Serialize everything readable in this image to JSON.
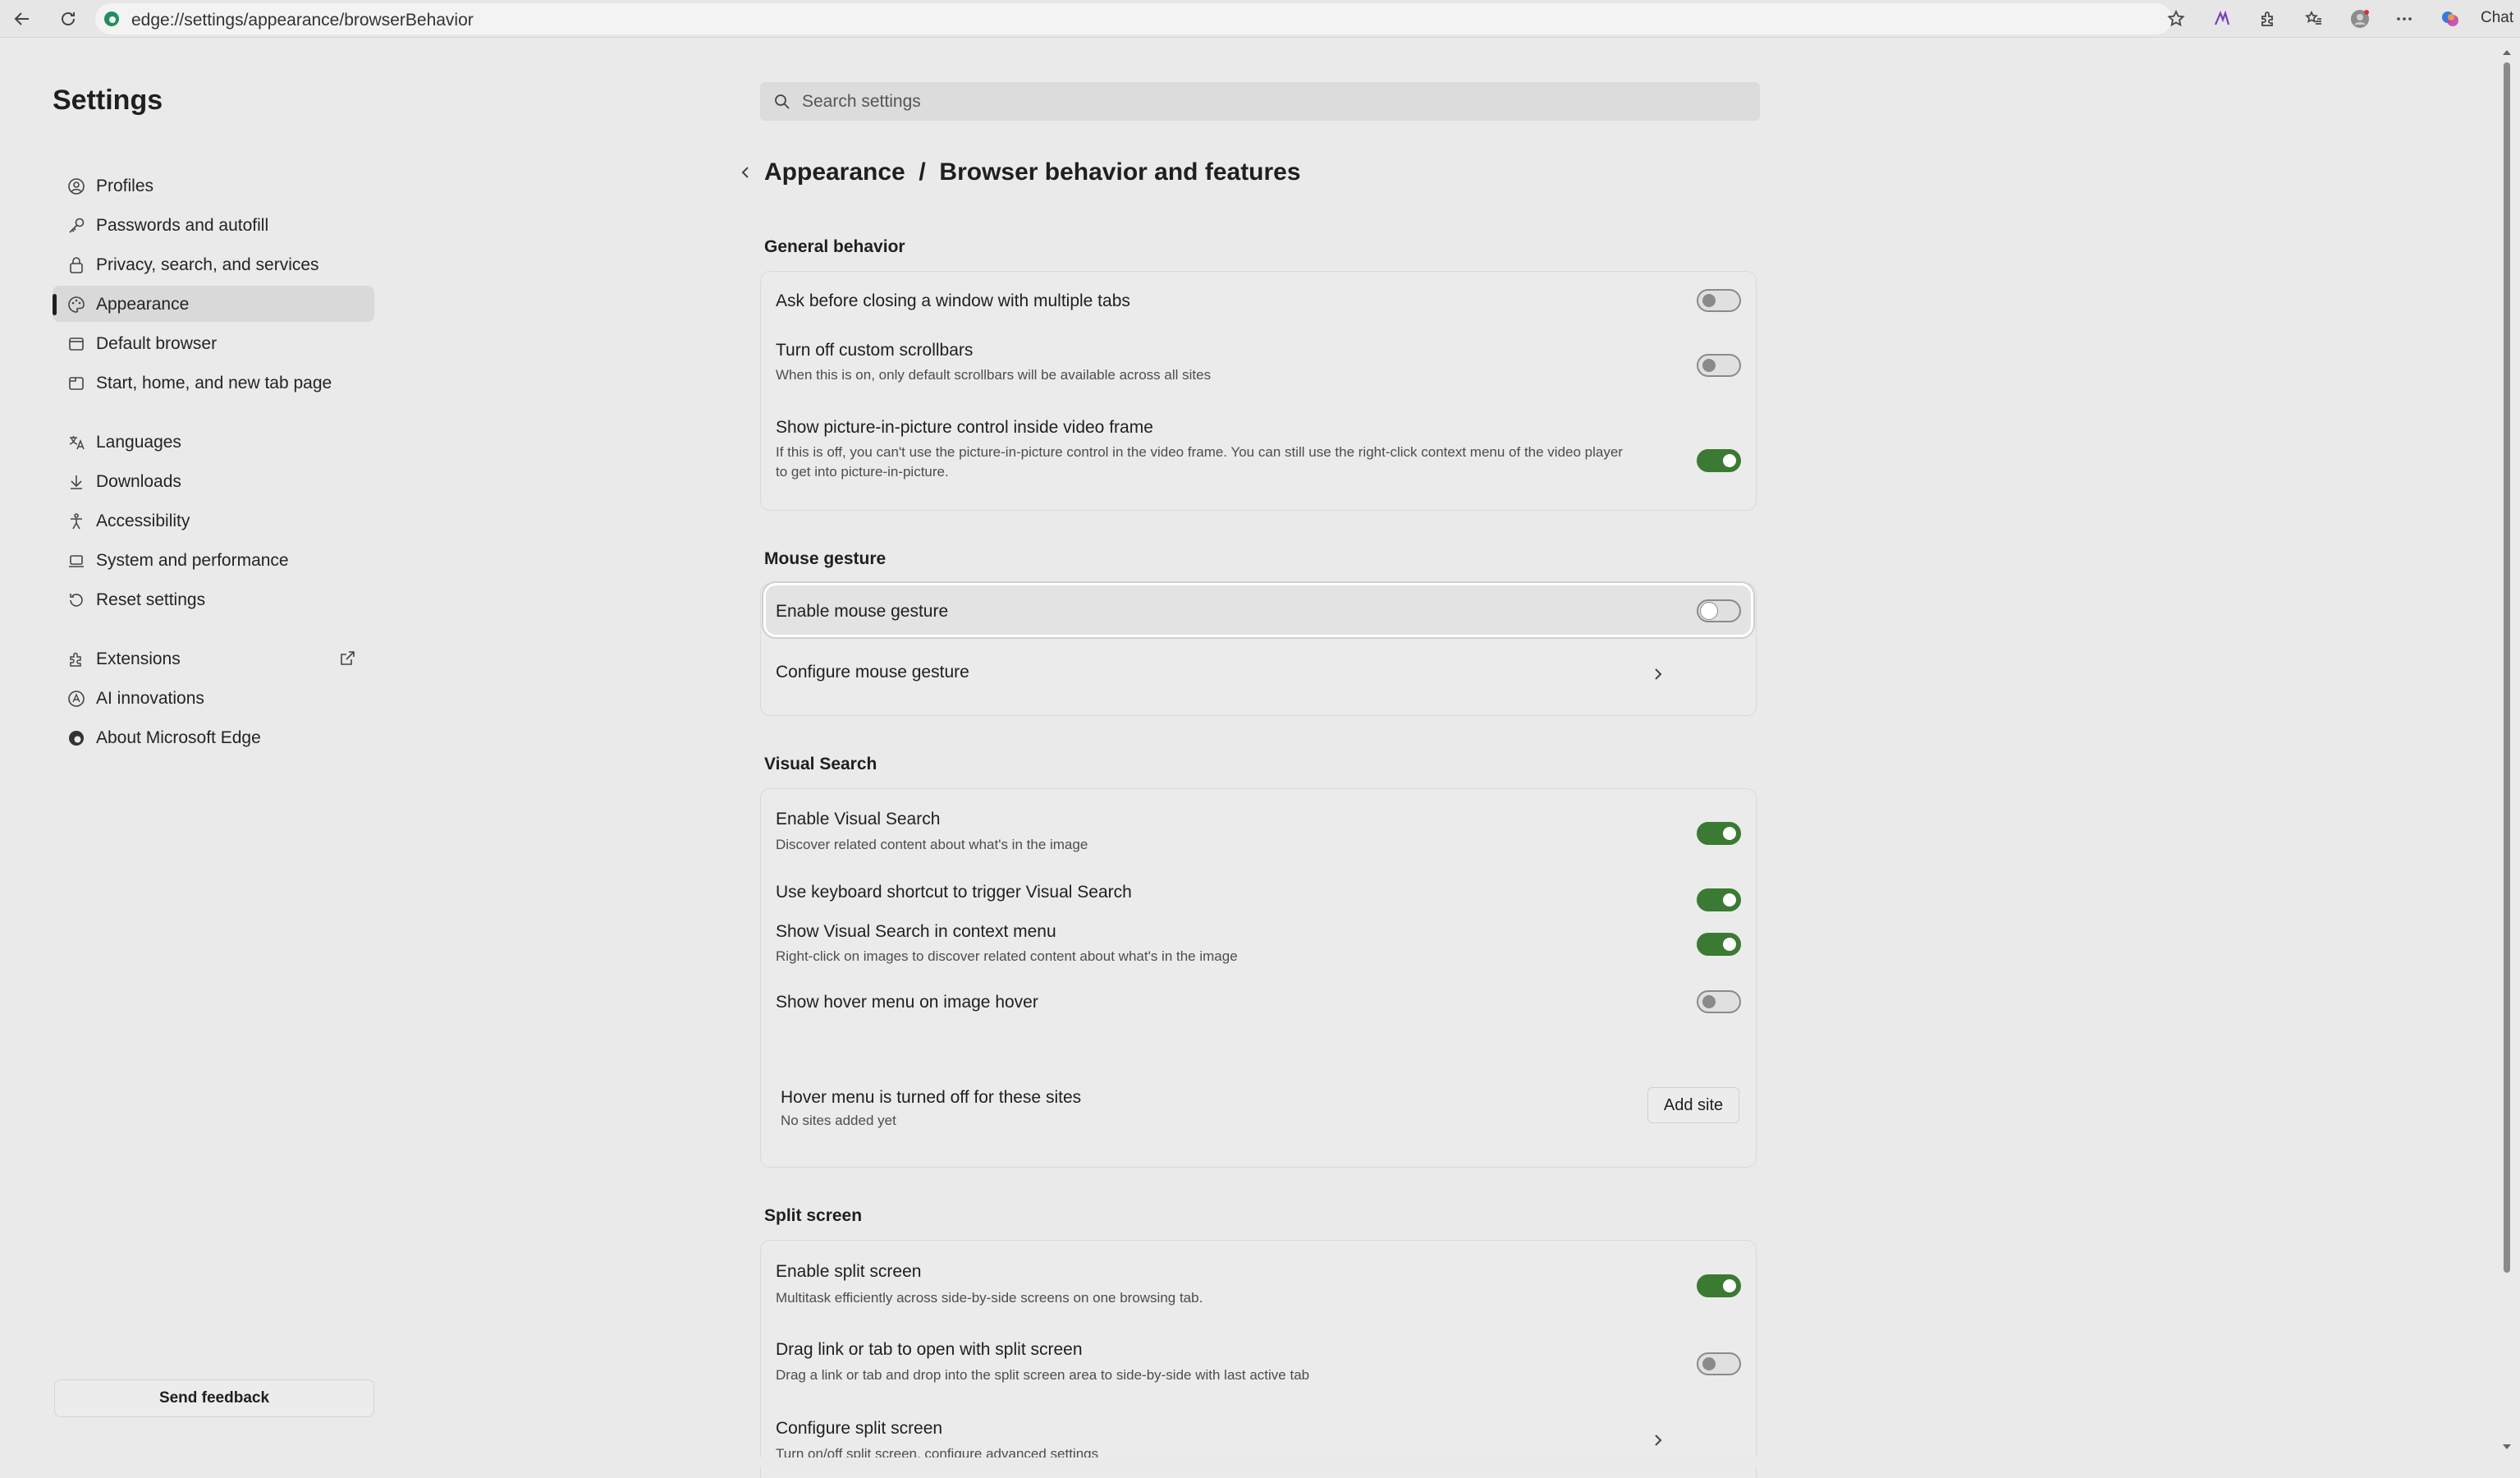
{
  "browser": {
    "url": "edge://settings/appearance/browserBehavior",
    "chat_label": "Chat"
  },
  "sidebar": {
    "title": "Settings",
    "items": [
      {
        "label": "Profiles",
        "icon": "profile-icon"
      },
      {
        "label": "Passwords and autofill",
        "icon": "key-icon"
      },
      {
        "label": "Privacy, search, and services",
        "icon": "lock-icon"
      },
      {
        "label": "Appearance",
        "icon": "palette-icon",
        "active": true
      },
      {
        "label": "Default browser",
        "icon": "browser-icon"
      },
      {
        "label": "Start, home, and new tab page",
        "icon": "home-tab-icon"
      },
      {
        "label": "Languages",
        "icon": "languages-icon"
      },
      {
        "label": "Downloads",
        "icon": "download-icon"
      },
      {
        "label": "Accessibility",
        "icon": "accessibility-icon"
      },
      {
        "label": "System and performance",
        "icon": "laptop-icon"
      },
      {
        "label": "Reset settings",
        "icon": "reset-icon"
      },
      {
        "label": "Extensions",
        "icon": "extensions-icon"
      },
      {
        "label": "AI innovations",
        "icon": "ai-icon"
      },
      {
        "label": "About Microsoft Edge",
        "icon": "edge-logo-icon"
      }
    ],
    "feedback_label": "Send feedback"
  },
  "main": {
    "search_placeholder": "Search settings",
    "page_title": "Appearance  /  Browser behavior and features",
    "sections": {
      "general": {
        "heading": "General behavior",
        "rows": [
          {
            "title": "Ask before closing a window with multiple tabs",
            "sub": "",
            "on": false
          },
          {
            "title": "Turn off custom scrollbars",
            "sub": "When this is on, only default scrollbars will be available across all sites",
            "on": false
          },
          {
            "title": "Show picture-in-picture control inside video frame",
            "sub": "If this is off, you can't use the picture-in-picture control in the video frame. You can still use the right-click context menu of the video player to get into picture-in-picture.",
            "on": true
          }
        ]
      },
      "mouse": {
        "heading": "Mouse gesture",
        "enable_title": "Enable mouse gesture",
        "enable_on": false,
        "configure_title": "Configure mouse gesture"
      },
      "visual": {
        "heading": "Visual Search",
        "rows": [
          {
            "title": "Enable Visual Search",
            "sub": "Discover related content about what's in the image",
            "on": true
          },
          {
            "title": "Use keyboard shortcut to trigger Visual Search",
            "sub": "",
            "on": true
          },
          {
            "title": "Show Visual Search in context menu",
            "sub": "Right-click on images to discover related content about what's in the image",
            "on": true
          },
          {
            "title": "Show hover menu on image hover",
            "sub": "",
            "on": false
          }
        ],
        "hover_off_title": "Hover menu is turned off for these sites",
        "hover_off_sub": "No sites added yet",
        "add_site_label": "Add site"
      },
      "split": {
        "heading": "Split screen",
        "rows": [
          {
            "title": "Enable split screen",
            "sub": "Multitask efficiently across side-by-side screens on one browsing tab.",
            "on": true
          },
          {
            "title": "Drag link or tab to open with split screen",
            "sub": "Drag a link or tab and drop into the split screen area to side-by-side with last active tab",
            "on": false
          }
        ],
        "configure_title": "Configure split screen",
        "configure_sub": "Turn on/off split screen, configure advanced settings"
      }
    }
  }
}
